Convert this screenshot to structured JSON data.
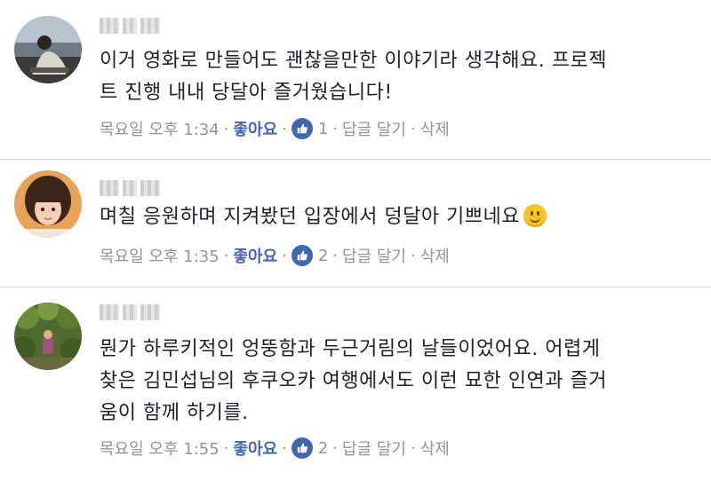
{
  "comments": [
    {
      "text_lines": [
        "이거 영화로 만들어도 괜찮을만한 이야기라 생각해요. 프로젝",
        "트 진행 내내 당달아 즐거웠습니다!"
      ],
      "time": "목요일 오후 1:34",
      "like_label": "좋아요",
      "like_count": "1",
      "reply_label": "답글 달기",
      "delete_label": "삭제"
    },
    {
      "text_lines": [
        "며칠 응원하며 지켜봤던 입장에서 덩달아 기쁘네요"
      ],
      "time": "목요일 오후 1:35",
      "like_label": "좋아요",
      "like_count": "2",
      "reply_label": "답글 달기",
      "delete_label": "삭제",
      "emoji": "smiley-emoji"
    },
    {
      "text_lines": [
        "뭔가 하루키적인 엉뚱함과 두근거림의 날들이었어요. 어렵게",
        "찾은 김민섭님의 후쿠오카 여행에서도 이런 묘한 인연과 즐거",
        "움이 함께 하기를."
      ],
      "time": "목요일 오후 1:55",
      "like_label": "좋아요",
      "like_count": "2",
      "reply_label": "답글 달기",
      "delete_label": "삭제"
    }
  ],
  "icons": {
    "like": "thumbs-up-icon",
    "avatar": "user-avatar"
  },
  "colors": {
    "accent": "#4267b2",
    "meta": "#90949c",
    "text": "#1d2129",
    "divider": "#dadde1"
  }
}
